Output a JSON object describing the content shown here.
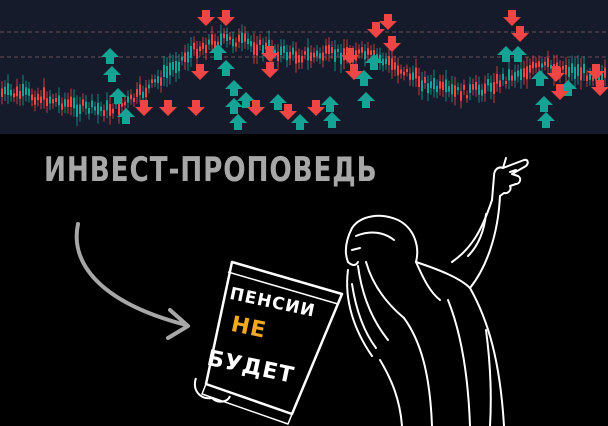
{
  "banner": {
    "title": "ИНВЕСТ-ПРОПОВЕДЬ",
    "book_line1": "ПЕНСИИ",
    "book_line2": "НЕ",
    "book_line3": "БУДЕТ"
  },
  "colors": {
    "chart_bg": "#161b2b",
    "up": "#14a394",
    "down": "#ef4545",
    "accent": "#f2a91f",
    "ink": "#ffffff",
    "title_gray": "#a7a7a7"
  },
  "icons": [
    "up-arrow-icon",
    "down-arrow-icon",
    "curved-arrow-icon",
    "pointing-hand-icon"
  ]
}
